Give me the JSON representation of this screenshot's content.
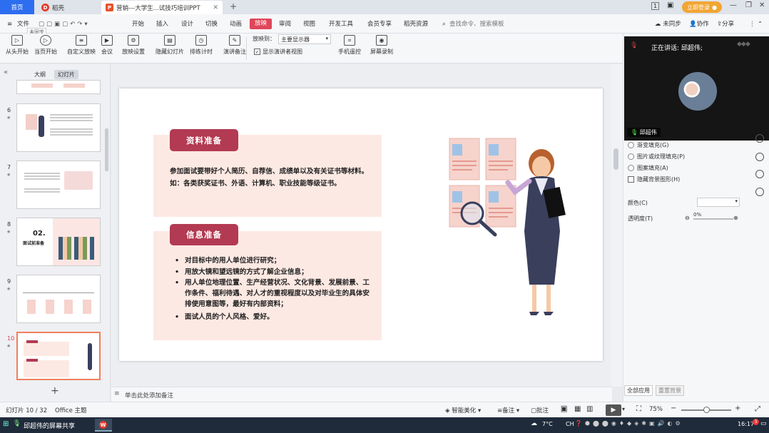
{
  "tabs": {
    "home": "首页",
    "daoke": "稻壳",
    "doc": "营销---大学生...试技巧培训PPT",
    "add": "+"
  },
  "titlebar": {
    "page_count": "1",
    "login": "立即登录"
  },
  "menu": {
    "file": "文件",
    "items": [
      "开始",
      "插入",
      "设计",
      "切换",
      "动画",
      "放映",
      "审阅",
      "视图",
      "开发工具",
      "会员专享",
      "稻壳资源"
    ],
    "search": "查找命令、搜索模板",
    "unsync": "未同步",
    "collab": "协作",
    "share": "分享",
    "tooltip": "未同步"
  },
  "ribbon": {
    "buttons": [
      "从头开始",
      "当页开始",
      "自定义放映",
      "会议",
      "放映设置",
      "隐藏幻灯片",
      "排练计时",
      "演讲备注"
    ],
    "monitor_label": "放映到：",
    "monitor_value": "主要显示器",
    "presenter_view": "显示演讲者视图",
    "remote": "手机遥控",
    "record": "屏幕录制"
  },
  "left": {
    "tab_outline": "大纲",
    "tab_slides": "幻灯片",
    "slide_numbers": [
      "6",
      "7",
      "8",
      "9",
      "10"
    ],
    "thumb8_title": "02.",
    "thumb8_sub": "面试前准备",
    "add": "+"
  },
  "slide": {
    "box1_title": "资料准备",
    "box1_text": "参加面试要带好个人简历、自荐信、成绩单以及有关证书等材料。如：各类获奖证书、外语、计算机、职业技能等级证书。",
    "box2_title": "信息准备",
    "bullets": [
      "对目标中的用人单位进行研究；",
      "用放大镜和望远镜的方式了解企业信息；",
      "用人单位地理位置、生产经营状况、文化背景、发展前景、工作条件、福利待遇、对人才的重视程度以及对毕业生的具体安排使用意图等，最好有内部资料；",
      "面试人员的个人风格、爱好。"
    ]
  },
  "notes": {
    "placeholder": "单击此处添加备注"
  },
  "status": {
    "slide_info": "幻灯片 10 / 32",
    "theme": "Office 主题",
    "beautify": "智能美化",
    "notes": "备注",
    "comments": "批注",
    "zoom": "75%"
  },
  "meeting": {
    "speaking": "正在讲话: 邱超伟;",
    "name": "邱超伟"
  },
  "format_panel": {
    "gradient_fill": "渐变填充(G)",
    "picture_fill": "图片或纹理填充(P)",
    "pattern_fill": "图案填充(A)",
    "hide_bg": "隐藏背景图形(H)",
    "color_label": "颜色(C)",
    "transparency_label": "透明度(T)",
    "transparency_value": "0%",
    "apply_all": "全部应用",
    "reset_bg": "重置背景"
  },
  "taskbar": {
    "share_label": "邱超伟的屏幕共享",
    "temp": "7°C",
    "lang": "CH",
    "time": "16:17",
    "notif": "3"
  },
  "colors": {
    "accent": "#b23a52",
    "box_fill": "#fde9e3",
    "tab_active": "#e0465a",
    "login": "#f2a533"
  }
}
